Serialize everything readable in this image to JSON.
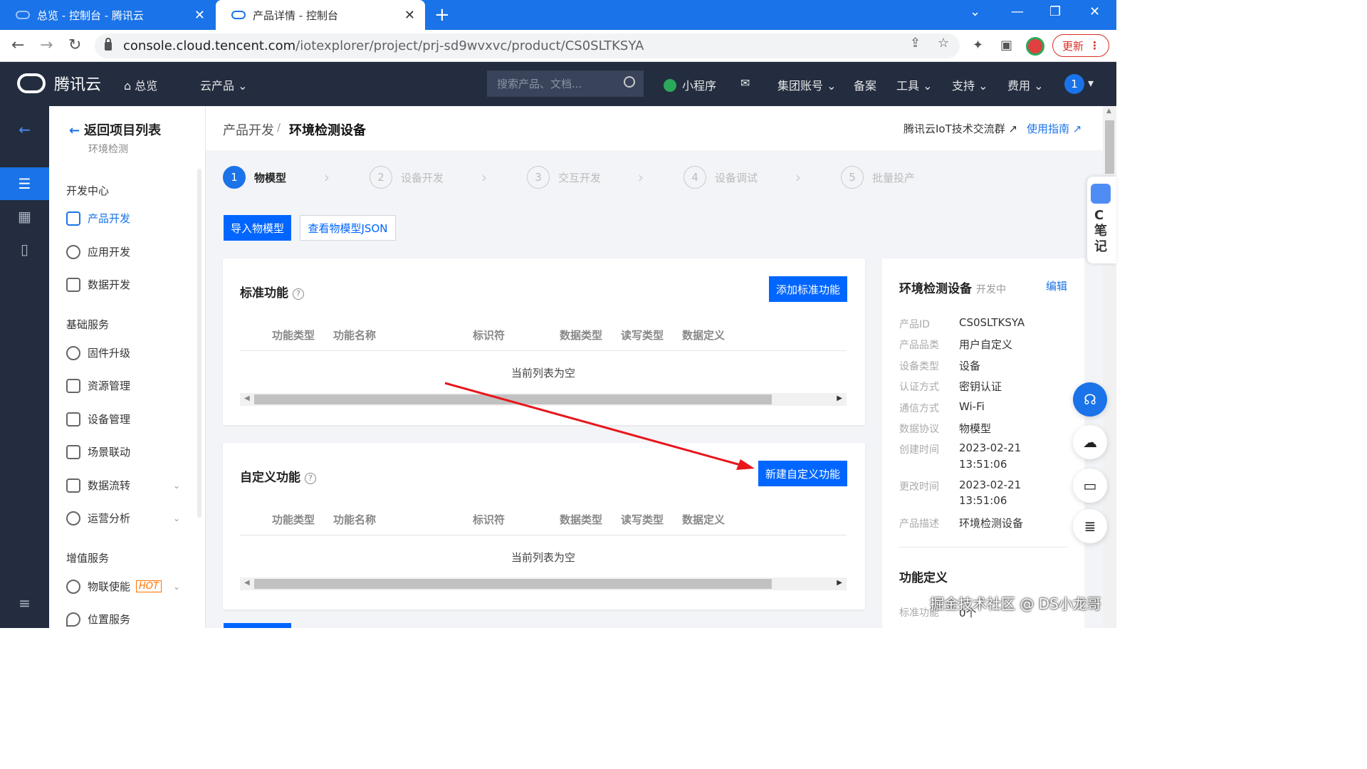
{
  "browser": {
    "tabs": [
      {
        "label": "总览 - 控制台 - 腾讯云"
      },
      {
        "label": "产品详情 - 控制台"
      }
    ],
    "url_domain": "console.cloud.tencent.com",
    "url_path": "/iotexplorer/project/prj-sd9wvxvc/product/CS0SLTKSYA",
    "update_label": "更新"
  },
  "topnav": {
    "brand": "腾讯云",
    "overview": "总览",
    "products": "云产品",
    "search_placeholder": "搜索产品、文档...",
    "miniprogram": "小程序",
    "group_account": "集团账号",
    "filing": "备案",
    "tools": "工具",
    "support": "支持",
    "billing": "费用",
    "avatar": "1"
  },
  "sidemenu": {
    "back": "返回项目列表",
    "project": "环境检测",
    "groups": [
      {
        "title": "开发中心",
        "items": [
          "产品开发",
          "应用开发",
          "数据开发"
        ]
      },
      {
        "title": "基础服务",
        "items": [
          "固件升级",
          "资源管理",
          "设备管理",
          "场景联动",
          "数据流转",
          "运营分析"
        ]
      },
      {
        "title": "增值服务",
        "items": [
          "物联使能",
          "位置服务"
        ]
      }
    ],
    "hot": "HOT"
  },
  "breadcrumb": {
    "parent": "产品开发",
    "sep": "/",
    "current": "环境检测设备",
    "link1": "腾讯云IoT技术交流群",
    "link2": "使用指南"
  },
  "steps": [
    {
      "num": "1",
      "label": "物模型"
    },
    {
      "num": "2",
      "label": "设备开发"
    },
    {
      "num": "3",
      "label": "交互开发"
    },
    {
      "num": "4",
      "label": "设备调试"
    },
    {
      "num": "5",
      "label": "批量投产"
    }
  ],
  "actions": {
    "import": "导入物模型",
    "view_json": "查看物模型JSON"
  },
  "standard": {
    "title": "标准功能",
    "add": "添加标准功能",
    "empty": "当前列表为空"
  },
  "custom": {
    "title": "自定义功能",
    "add": "新建自定义功能",
    "empty": "当前列表为空"
  },
  "columns": [
    "功能类型",
    "功能名称",
    "标识符",
    "数据类型",
    "读写类型",
    "数据定义"
  ],
  "info": {
    "name": "环境检测设备",
    "status": "开发中",
    "edit": "编辑",
    "rows": [
      {
        "label": "产品ID",
        "value": "CS0SLTKSYA"
      },
      {
        "label": "产品品类",
        "value": "用户自定义"
      },
      {
        "label": "设备类型",
        "value": "设备"
      },
      {
        "label": "认证方式",
        "value": "密钥认证"
      },
      {
        "label": "通信方式",
        "value": "Wi-Fi"
      },
      {
        "label": "数据协议",
        "value": "物模型"
      },
      {
        "label": "创建时间",
        "value": "2023-02-21",
        "value2": "13:51:06"
      },
      {
        "label": "更改时间",
        "value": "2023-02-21",
        "value2": "13:51:06"
      },
      {
        "label": "产品描述",
        "value": "环境检测设备"
      }
    ],
    "func_def_title": "功能定义",
    "std_label": "标准功能",
    "std_count": "0个"
  },
  "notes_widget": {
    "letter": "C",
    "text": "笔记"
  },
  "watermark": "掘金技术社区 @ DS小龙哥",
  "colors": {
    "primary": "#0066ff",
    "nav": "#232d3f",
    "arrow": "#e8161b"
  }
}
